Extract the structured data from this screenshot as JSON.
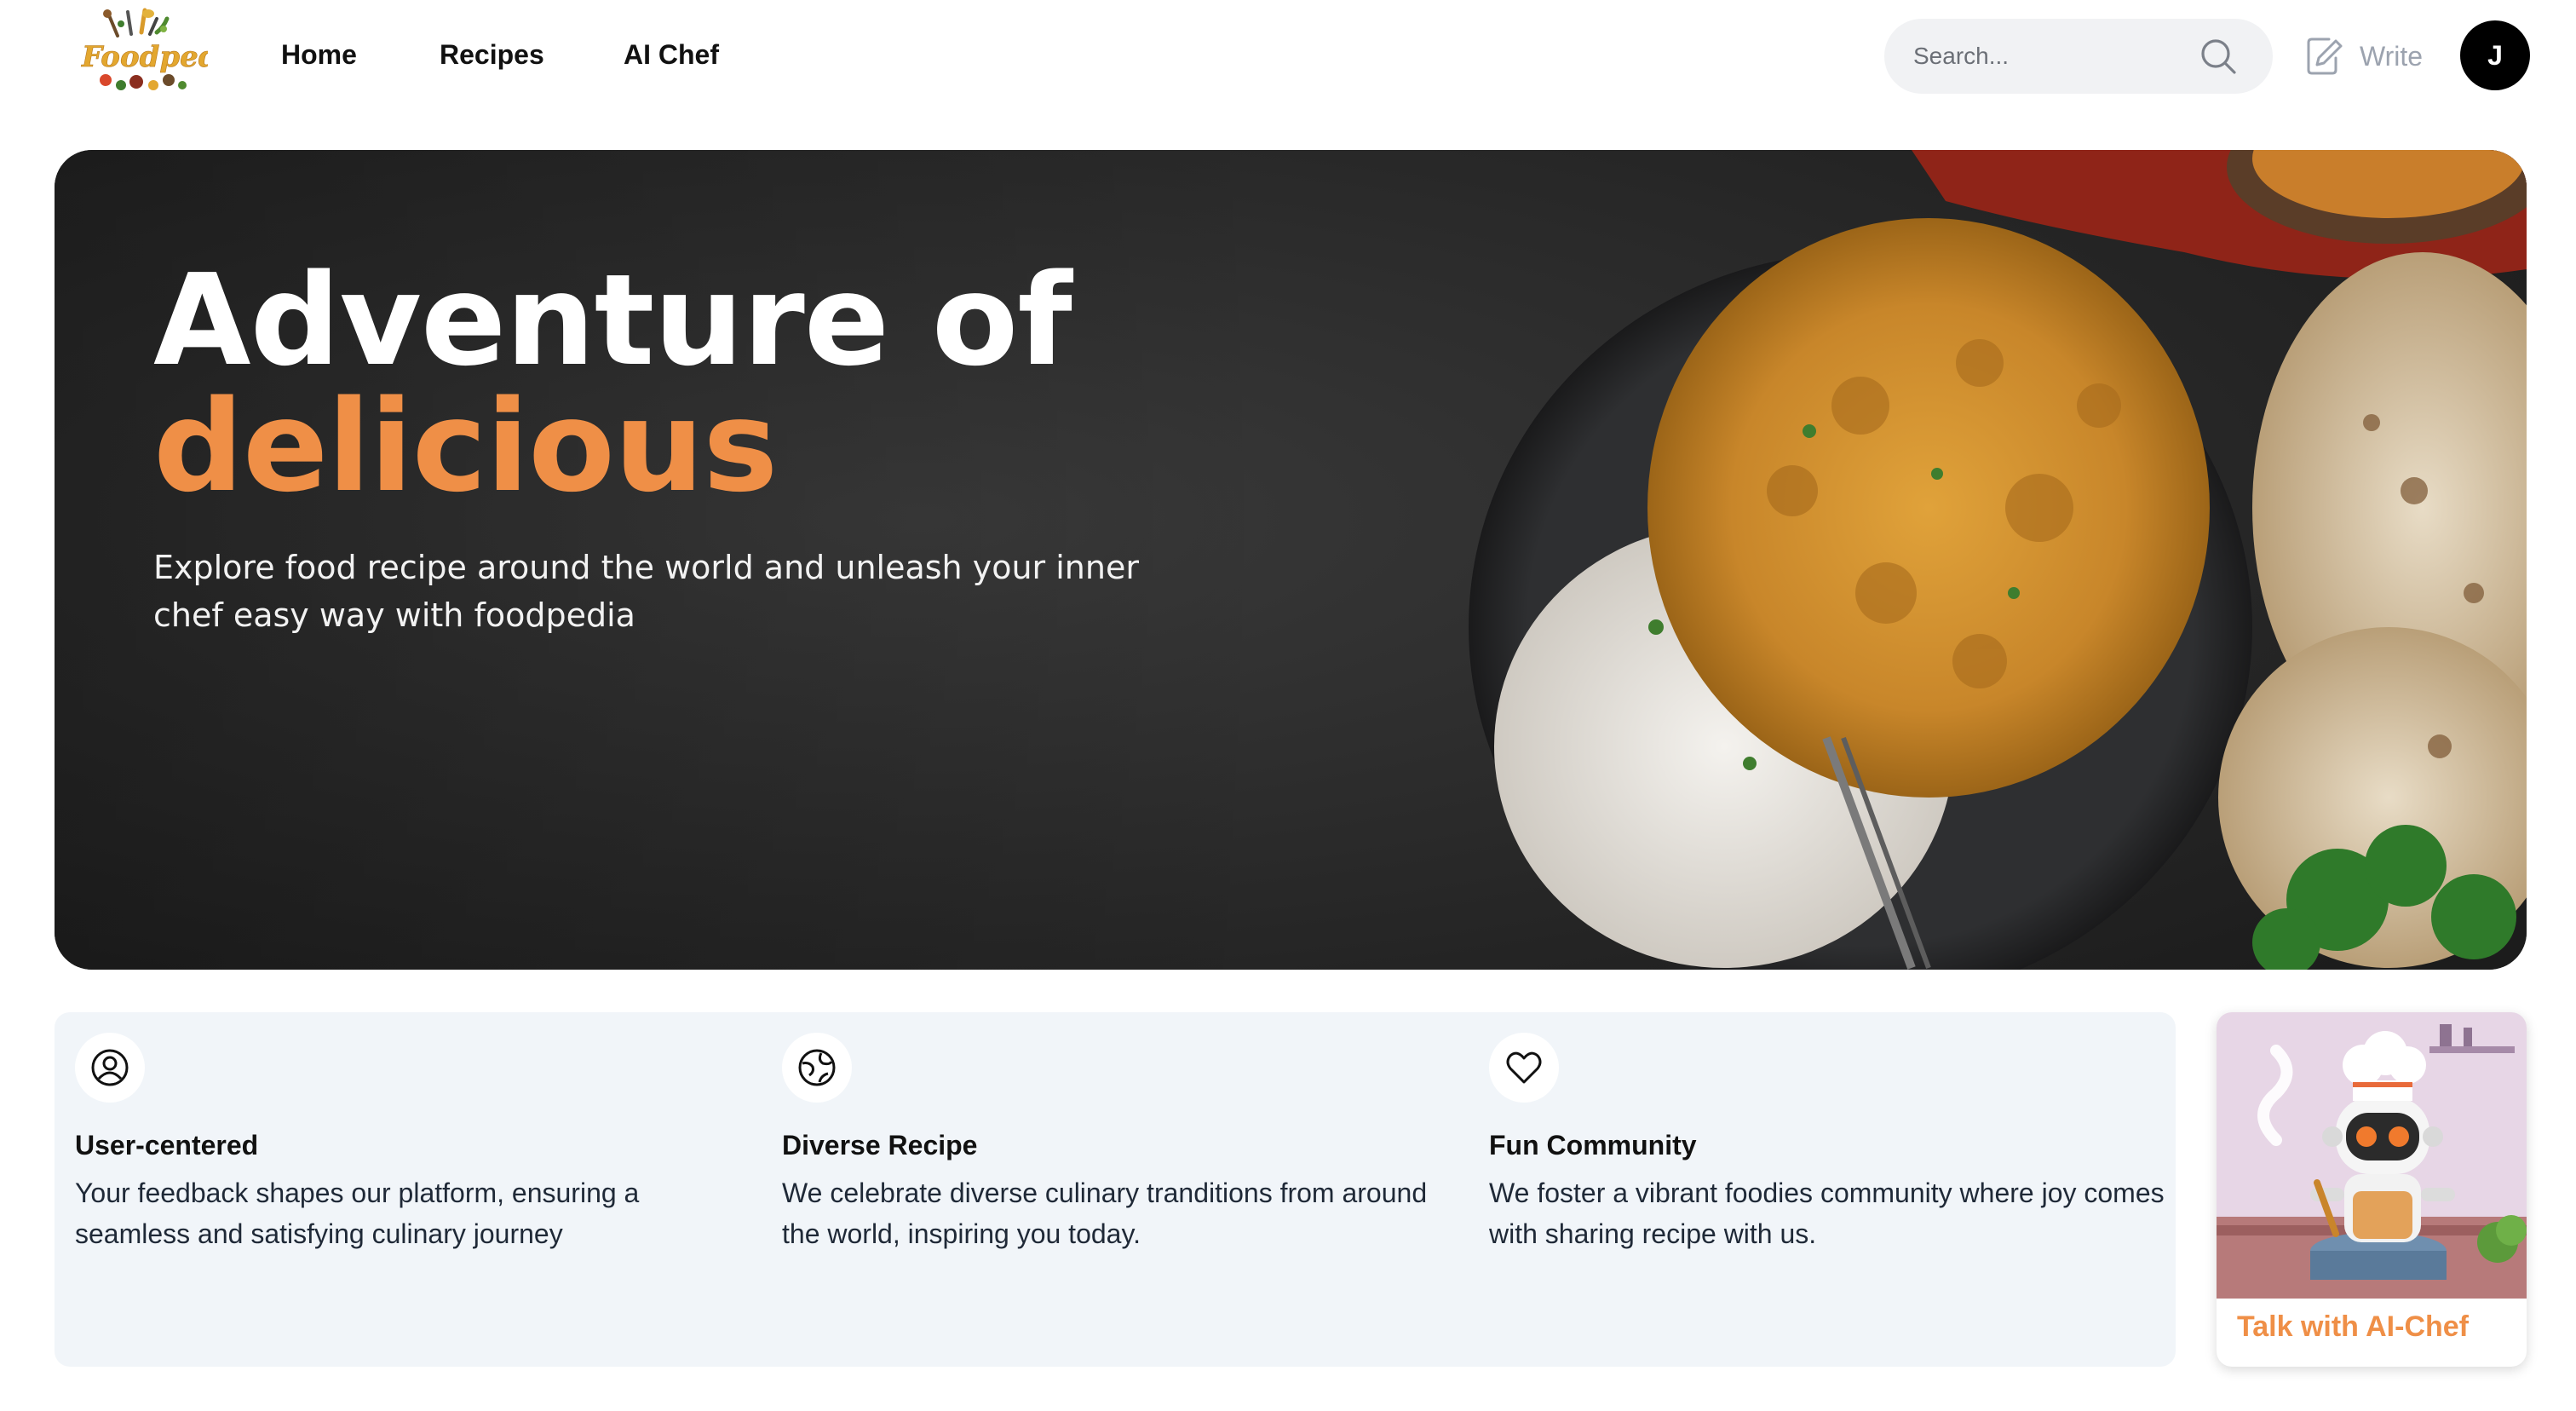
{
  "brand": {
    "logo_text": "Foodpedia"
  },
  "nav": {
    "home": "Home",
    "recipes": "Recipes",
    "ai_chef": "AI Chef"
  },
  "search": {
    "placeholder": "Search...",
    "value": ""
  },
  "write": {
    "label": "Write"
  },
  "user": {
    "initial": "J"
  },
  "hero": {
    "title_line1": "Adventure of",
    "title_line2": "delicious",
    "subtitle": "Explore food recipe around the world and unleash your inner chef easy way with foodpedia"
  },
  "features": [
    {
      "icon": "user-circle-icon",
      "title": "User-centered",
      "description": "Your feedback shapes our platform, ensuring a seamless and satisfying culinary journey"
    },
    {
      "icon": "globe-icon",
      "title": "Diverse Recipe",
      "description": "We celebrate diverse culinary tranditions from around the world, inspiring you today."
    },
    {
      "icon": "heart-icon",
      "title": "Fun Community",
      "description": "We foster a vibrant foodies community where joy comes with sharing recipe with us."
    }
  ],
  "ai_card": {
    "label": "Talk with AI-Chef"
  },
  "colors": {
    "accent": "#ef8f47",
    "hero_bg": "#262626",
    "features_bg": "#f1f5f9"
  }
}
